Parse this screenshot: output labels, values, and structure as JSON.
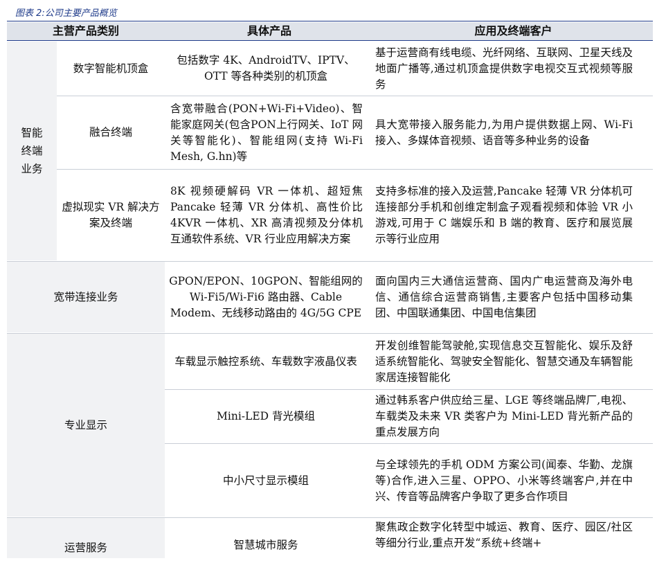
{
  "caption": "图表 2:公司主要产品概览",
  "header": {
    "category": "主营产品类别",
    "product": "具体产品",
    "application": "应用及终端客户"
  },
  "groups": {
    "smart": "智能\n终端\n业务",
    "broadband": "宽带连接业务",
    "display": "专业显示",
    "ops": "运营服务"
  },
  "rows": [
    {
      "sub": "数字智能机顶盒",
      "product": "包括数字 4K、AndroidTV、IPTV、OTT 等各种类别的机顶盒",
      "app": "基于运营商有线电缆、光纤网络、互联网、卫星天线及地面广播等,通过机顶盒提供数字电视交互式视频等服务"
    },
    {
      "sub": "融合终端",
      "product": "含宽带融合(PON+Wi-Fi+Video)、智能家庭网关(包含PON上行网关、IoT 网关等智能化)、智能组网(支持 Wi-Fi Mesh, G.hn)等",
      "app": "具大宽带接入服务能力,为用户提供数据上网、Wi-Fi 接入、多媒体音视频、语音等多种业务的设备"
    },
    {
      "sub": "虚拟现实 VR 解决方案及终端",
      "product": "8K 视频硬解码 VR 一体机、超短焦 Pancake 轻薄 VR 分体机、高性价比 4KVR 一体机、XR 高清视频及分体机互通软件系统、VR 行业应用解决方案",
      "app": "支持多标准的接入及运营,Pancake 轻薄 VR 分体机可连接部分手机和创维定制盒子观看视频和体验 VR 小游戏,可用于 C 端娱乐和 B 端的教育、医疗和展览展示等行业应用"
    },
    {
      "sub": "",
      "product": "GPON/EPON、10GPON、智能组网的 Wi-Fi5/Wi-Fi6 路由器、Cable Modem、无线移动路由的 4G/5G CPE",
      "app": "面向国内三大通信运营商、国内广电运营商及海外电信、通信综合运营商销售,主要客户包括中国移动集团、中国联通集团、中国电信集团"
    },
    {
      "sub": "",
      "product": "车载显示触控系统、车载数字液晶仪表",
      "app": "开发创维智能驾驶舱,实现信息交互智能化、娱乐及舒适系统智能化、驾驶安全智能化、智慧交通及车辆智能家居连接智能化"
    },
    {
      "sub": "",
      "product": "Mini-LED 背光模组",
      "app": "通过韩系客户供应给三星、LGE 等终端品牌厂,电视、车载类及未来 VR 类客户为 Mini-LED 背光新产品的重点发展方向"
    },
    {
      "sub": "",
      "product": "中小尺寸显示模组",
      "app": "与全球领先的手机 ODM 方案公司(闻泰、华勤、龙旗等)合作,进入三星、OPPO、小米等终端客户,并在中兴、传音等品牌客户争取了更多合作项目"
    },
    {
      "sub": "",
      "product": "智慧城市服务",
      "app": "聚焦政企数字化转型中城运、教育、医疗、园区/社区等细分行业,重点开发“系统+终端+"
    }
  ]
}
